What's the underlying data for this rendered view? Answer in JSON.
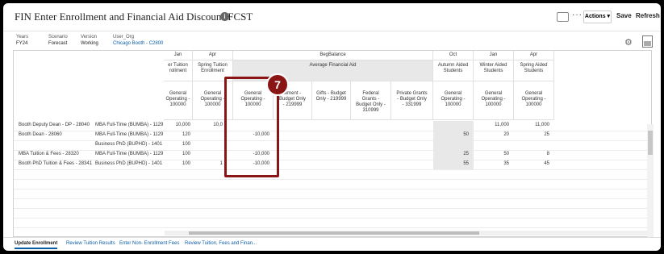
{
  "header": {
    "title": "FIN Enter Enrollment and Financial Aid Discount-FCST",
    "actions_label": "Actions ▾",
    "save_label": "Save",
    "refresh_label": "Refresh"
  },
  "pov": [
    {
      "label": "Years",
      "value": "FY24"
    },
    {
      "label": "Scenario",
      "value": "Forecast"
    },
    {
      "label": "Version",
      "value": "Working"
    },
    {
      "label": "User_Org",
      "value": "Chicago Booth - C2800"
    }
  ],
  "grid": {
    "period_headers": [
      "Jan",
      "Apr",
      "BegBalance",
      "Oct",
      "Jan",
      "Apr"
    ],
    "group_headers": [
      "er Tuition\nrollment",
      "Spring Tuition\nEnrollment",
      "Average Financial Aid",
      "Autumn Aided\nStudents",
      "Winter Aided\nStudents",
      "Spring Aided\nStudents"
    ],
    "account_headers": [
      "General\nOperating -\n100000",
      "General\nOperating -\n100000",
      "General\nOperating -\n100000",
      "wment -\nBudget Only\n- 219999",
      "Gifts - Budget\nOnly - 219999",
      "Federal\nGrants -\nBudget Only -\n310999",
      "Private Grants\n- Budget Only\n- 331999",
      "General\nOperating -\n100000",
      "General\nOperating -\n100000",
      "General\nOperating -\n100000"
    ],
    "rows": [
      {
        "entity": "Booth Deputy Dean - DP - 28040",
        "program": "MBA Full-Time (BUMBA) - 1129",
        "values": [
          "10,000",
          "10,0",
          "",
          "",
          "",
          "",
          "",
          "",
          "11,000",
          "11,000"
        ]
      },
      {
        "entity": "Booth Dean - 28060",
        "program": "MBA Full-Time (BUMBA) - 1129",
        "values": [
          "120",
          "",
          "-10,000",
          "",
          "",
          "",
          "",
          "50",
          "20",
          "25"
        ]
      },
      {
        "entity": "",
        "program": "Business PhD (BUPHD) - 1401",
        "values": [
          "100",
          "",
          "",
          "",
          "",
          "",
          "",
          "",
          "",
          ""
        ]
      },
      {
        "entity": "MBA Tuition & Fees - 28320",
        "program": "MBA Full-Time (BUMBA) - 1129",
        "values": [
          "100",
          "",
          "-10,000",
          "",
          "",
          "",
          "",
          "25",
          "50",
          "8"
        ]
      },
      {
        "entity": "Booth PhD Tuition & Fees - 28341",
        "program": "Business PhD (BUPHD) - 1401",
        "values": [
          "100",
          "1",
          "-10,000",
          "",
          "",
          "",
          "",
          "55",
          "35",
          "45"
        ]
      }
    ]
  },
  "callout": {
    "number": "7"
  },
  "tabs": [
    {
      "label": "Update Enrollment",
      "active": true
    },
    {
      "label": "Review Tuition Results",
      "active": false
    },
    {
      "label": "Enter Non- Enrollment Fees",
      "active": false
    },
    {
      "label": "Review Tuition, Fees and Finan...",
      "active": false
    }
  ],
  "colors": {
    "accent": "#0b5ea8",
    "callout": "#8a1515"
  }
}
